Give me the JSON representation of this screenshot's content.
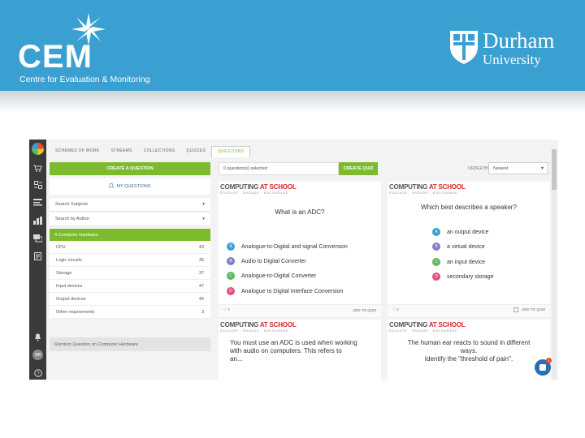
{
  "header": {
    "cem_logo": "CEM",
    "cem_tagline": "Centre for Evaluation & Monitoring",
    "durham_name": "Durham",
    "durham_sub": "University"
  },
  "rail": {
    "icons": [
      "logo-icon",
      "cart-icon",
      "quiz-icon",
      "list-icon",
      "chart-icon",
      "chat-icon",
      "book-icon",
      "bell-icon",
      "avatar",
      "help-icon"
    ],
    "avatar_initials": "MB"
  },
  "tabs": [
    "SCHEMES OF WORK",
    "STREAMS",
    "COLLECTIONS",
    "QUIZZES",
    "QUESTIONS"
  ],
  "left": {
    "create_question": "CREATE A QUESTION",
    "my_questions": "MY QUESTIONS",
    "subjects_placeholder": "Search Subjects",
    "author_placeholder": "Search by Author",
    "category": "4 Computer Hardware",
    "items": [
      {
        "label": "CPU",
        "count": "43"
      },
      {
        "label": "Logic circuits",
        "count": "35"
      },
      {
        "label": "Storage",
        "count": "37"
      },
      {
        "label": "Input devices",
        "count": "47"
      },
      {
        "label": "Output devices",
        "count": "40"
      },
      {
        "label": "Other requirements",
        "count": "3"
      }
    ],
    "random": "Random Question on Computer Hardware"
  },
  "toolbar": {
    "selected": "0 question(s) selected",
    "create_quiz": "CREATE QUIZ",
    "order_by": "ORDER BY",
    "order_value": "Newest"
  },
  "cards": [
    {
      "brand": "COMPUTING",
      "brand_accent": "AT SCHOOL",
      "tagline": "EDUCATE · ENGAGE · ENCOURAGE",
      "question": "What is an ADC?",
      "answers": [
        {
          "letter": "A",
          "text": "Analogue-to-Digital and signal Conversion",
          "color": "#3aa0d1"
        },
        {
          "letter": "B",
          "text": "Audio to Digital Converter",
          "color": "#7e7ec9"
        },
        {
          "letter": "C",
          "text": "Analogue-to-Digital Converter",
          "color": "#5bb85c"
        },
        {
          "letter": "D",
          "text": "Analogue to Digital Interface Conversion",
          "color": "#e04e7b"
        }
      ],
      "likes": "2",
      "add": "ADD TO QUIZ"
    },
    {
      "brand": "COMPUTING",
      "brand_accent": "AT SCHOOL",
      "tagline": "EDUCATE · ENGAGE · ENCOURAGE",
      "question": "Which best describes a speaker?",
      "answers": [
        {
          "letter": "A",
          "text": "an output device",
          "color": "#3aa0d1"
        },
        {
          "letter": "B",
          "text": "a virtual device",
          "color": "#7e7ec9"
        },
        {
          "letter": "C",
          "text": "an input device",
          "color": "#5bb85c"
        },
        {
          "letter": "D",
          "text": "secondary storage",
          "color": "#e04e7b"
        }
      ],
      "likes": "2",
      "add": "ADD TO QUIZ"
    },
    {
      "brand": "COMPUTING",
      "brand_accent": "AT SCHOOL",
      "tagline": "EDUCATE · ENGAGE · ENCOURAGE",
      "question_lines": [
        "You must use an ADC is used when working",
        "with audio on computers.  This refers to",
        "an..."
      ]
    },
    {
      "brand": "COMPUTING",
      "brand_accent": "AT SCHOOL",
      "tagline": "EDUCATE · ENGAGE · ENCOURAGE",
      "question_lines": [
        "The human ear reacts to sound in different",
        "ways.",
        "Identify the \"threshold of pain\"."
      ]
    }
  ],
  "chat_badge": "1"
}
